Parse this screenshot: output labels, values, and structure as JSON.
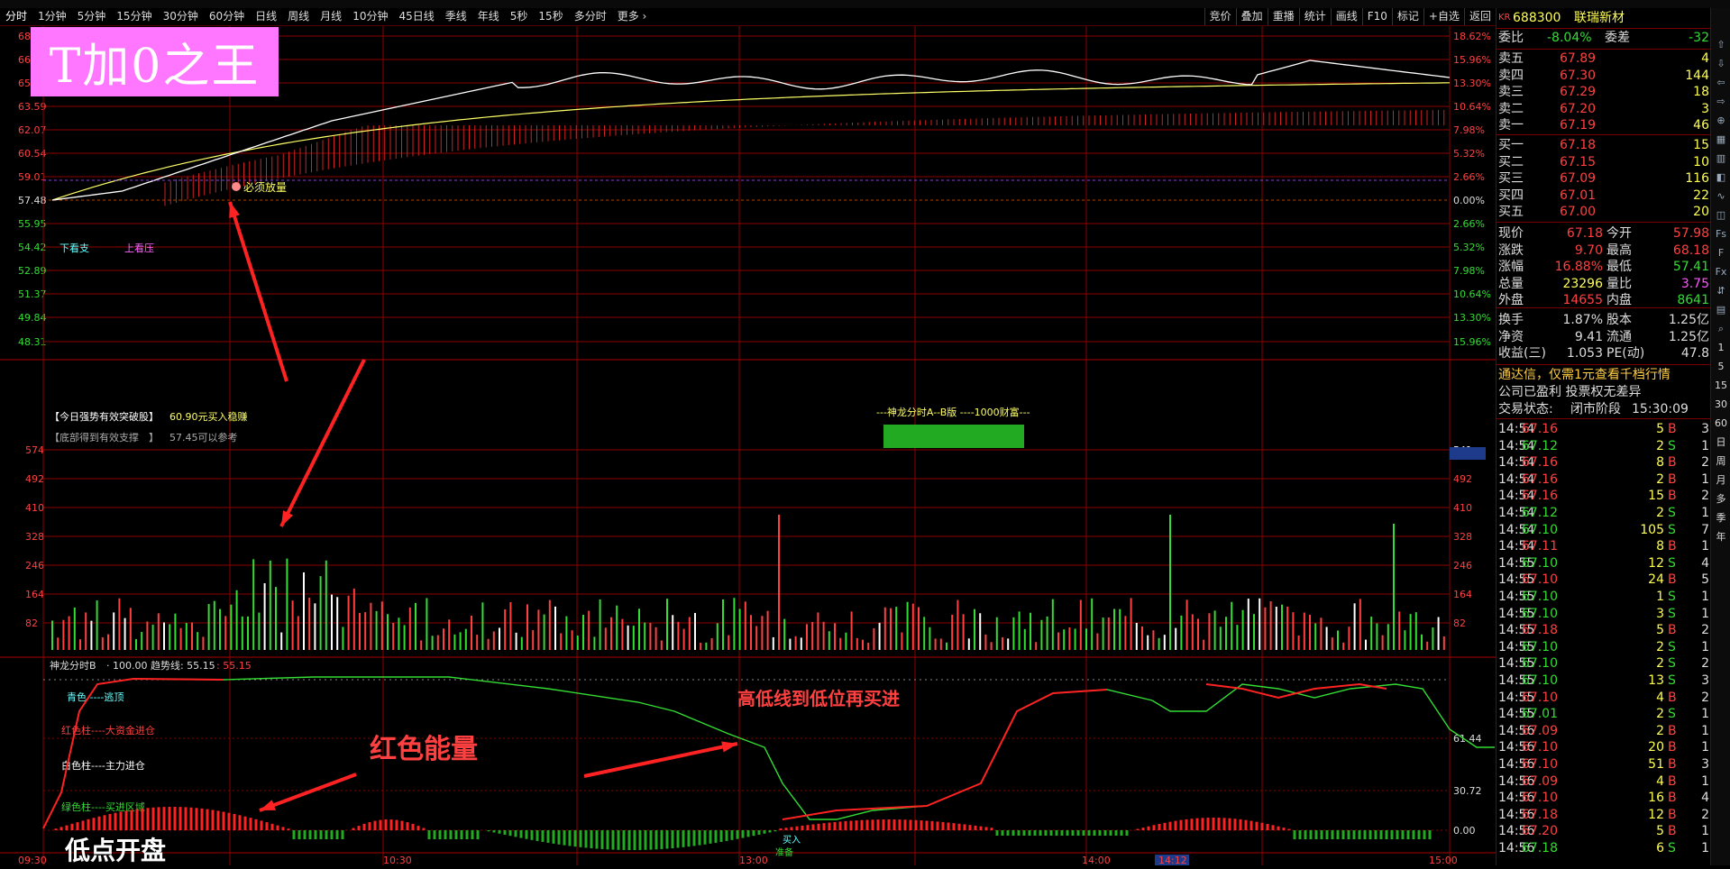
{
  "toolbar": {
    "tabs": [
      "分时",
      "1分钟",
      "5分钟",
      "15分钟",
      "30分钟",
      "60分钟",
      "日线",
      "周线",
      "月线",
      "10分钟",
      "45日线",
      "季线",
      "年线",
      "5秒",
      "15秒",
      "多分时",
      "更多 ›"
    ],
    "right": [
      "竞价",
      "叠加",
      "重播",
      "统计",
      "画线",
      "F10",
      "标记",
      "+自选",
      "返回"
    ]
  },
  "logo": "T加0之王",
  "price_axis": {
    "left": [
      "68",
      "66",
      "65.12",
      "63.59",
      "62.07",
      "60.54",
      "59.01",
      "57.48",
      "55.95",
      "54.42",
      "52.89",
      "51.37",
      "49.84",
      "48.31"
    ],
    "right": [
      "18.62%",
      "15.96%",
      "13.30%",
      "10.64%",
      "7.98%",
      "5.32%",
      "2.66%",
      "0.00%",
      "2.66%",
      "5.32%",
      "7.98%",
      "10.64%",
      "13.30%",
      "15.96%"
    ]
  },
  "volume_axis": {
    "left": [
      "574",
      "492",
      "410",
      "328",
      "246",
      "164",
      "82"
    ],
    "right": [
      "541",
      "492",
      "410",
      "328",
      "246",
      "164",
      "82"
    ]
  },
  "chart_labels": {
    "must_volume": "必须放量",
    "lower_look": "下看支",
    "upper_look": "上看压",
    "breakthrough_prefix": "【今日强势有效突破股】",
    "breakthrough_value": "60.90元买入稳赚",
    "bottom_prefix": "【底部得到有效支撑　】",
    "bottom_value": "57.45可以参考",
    "banner": "---神龙分时A--B版 ----1000财富---"
  },
  "indicator": {
    "title": "神龙分时B",
    "values_line": "· 100.00  趋势线: 55.15",
    "second_value": ": 55.15",
    "axis": [
      "61.44",
      "30.72",
      "0.00"
    ],
    "legend": [
      "青色 ----逃顶",
      "红色柱----大资金进仓",
      "白色柱----主力进仓",
      "绿色柱----买进区域"
    ],
    "low_label": "准备",
    "buy_label": "买入"
  },
  "time_axis": [
    "09:30",
    "10:30",
    "13:00",
    "14:00",
    "14:12",
    "15:00"
  ],
  "annotations": {
    "low_open": "低点开盘",
    "red_energy": "红色能量",
    "buy_again": "高低线到低位再买进"
  },
  "quote": {
    "code_prefix": "KR",
    "code": "688300",
    "name": "联瑞新材",
    "webi_label": "委比",
    "webi": "-8.04%",
    "weicha_label": "委差",
    "weicha": "-32",
    "asks": [
      {
        "label": "卖五",
        "price": "67.89",
        "vol": "4"
      },
      {
        "label": "卖四",
        "price": "67.30",
        "vol": "144"
      },
      {
        "label": "卖三",
        "price": "67.29",
        "vol": "18"
      },
      {
        "label": "卖二",
        "price": "67.20",
        "vol": "3"
      },
      {
        "label": "卖一",
        "price": "67.19",
        "vol": "46"
      }
    ],
    "bids": [
      {
        "label": "买一",
        "price": "67.18",
        "vol": "15"
      },
      {
        "label": "买二",
        "price": "67.15",
        "vol": "10"
      },
      {
        "label": "买三",
        "price": "67.09",
        "vol": "116"
      },
      {
        "label": "买四",
        "price": "67.01",
        "vol": "22"
      },
      {
        "label": "买五",
        "price": "67.00",
        "vol": "20"
      }
    ],
    "stats": [
      {
        "l1": "现价",
        "v1": "67.18",
        "c1": "#ff4040",
        "l2": "今开",
        "v2": "57.98",
        "c2": "#ff4040"
      },
      {
        "l1": "涨跌",
        "v1": "9.70",
        "c1": "#ff4040",
        "l2": "最高",
        "v2": "68.18",
        "c2": "#ff4040"
      },
      {
        "l1": "涨幅",
        "v1": "16.88%",
        "c1": "#ff4040",
        "l2": "最低",
        "v2": "57.41",
        "c2": "#33dd33"
      },
      {
        "l1": "总量",
        "v1": "23296",
        "c1": "#ffff55",
        "l2": "量比",
        "v2": "3.75",
        "c2": "#ff55ff"
      },
      {
        "l1": "外盘",
        "v1": "14655",
        "c1": "#ff4040",
        "l2": "内盘",
        "v2": "8641",
        "c2": "#33dd33"
      }
    ],
    "stats2": [
      {
        "l1": "换手",
        "v1": "1.87%",
        "l2": "股本",
        "v2": "1.25亿"
      },
      {
        "l1": "净资",
        "v1": "9.41",
        "l2": "流通",
        "v2": "1.25亿"
      },
      {
        "l1": "收益(三)",
        "v1": "1.053",
        "l2": "PE(动)",
        "v2": "47.8"
      }
    ],
    "notice": "通达信，仅需1元查看千档行情",
    "company": "公司已盈利 投票权无差异",
    "status_label": "交易状态:",
    "status": "闭市阶段",
    "status_time": "15:30:09"
  },
  "trades": [
    [
      "14:54",
      "67.16",
      "5",
      "B",
      "3"
    ],
    [
      "14:54",
      "67.12",
      "2",
      "S",
      "1"
    ],
    [
      "14:54",
      "67.16",
      "8",
      "B",
      "2"
    ],
    [
      "14:54",
      "67.16",
      "2",
      "B",
      "1"
    ],
    [
      "14:54",
      "67.16",
      "15",
      "B",
      "2"
    ],
    [
      "14:54",
      "67.12",
      "2",
      "S",
      "1"
    ],
    [
      "14:54",
      "67.10",
      "105",
      "S",
      "7"
    ],
    [
      "14:54",
      "67.11",
      "8",
      "B",
      "1"
    ],
    [
      "14:55",
      "67.10",
      "12",
      "S",
      "4"
    ],
    [
      "14:55",
      "67.10",
      "24",
      "B",
      "5"
    ],
    [
      "14:55",
      "67.10",
      "1",
      "S",
      "1"
    ],
    [
      "14:55",
      "67.10",
      "3",
      "S",
      "1"
    ],
    [
      "14:55",
      "67.18",
      "5",
      "B",
      "2"
    ],
    [
      "14:55",
      "67.10",
      "2",
      "S",
      "1"
    ],
    [
      "14:55",
      "67.10",
      "2",
      "S",
      "2"
    ],
    [
      "14:55",
      "67.10",
      "13",
      "S",
      "3"
    ],
    [
      "14:55",
      "67.10",
      "4",
      "B",
      "2"
    ],
    [
      "14:55",
      "67.01",
      "2",
      "S",
      "1"
    ],
    [
      "14:56",
      "67.09",
      "2",
      "B",
      "1"
    ],
    [
      "14:56",
      "67.10",
      "20",
      "B",
      "1"
    ],
    [
      "14:56",
      "67.10",
      "51",
      "B",
      "3"
    ],
    [
      "14:56",
      "67.09",
      "4",
      "B",
      "1"
    ],
    [
      "14:56",
      "67.10",
      "16",
      "B",
      "4"
    ],
    [
      "14:56",
      "67.18",
      "12",
      "B",
      "2"
    ],
    [
      "14:56",
      "67.20",
      "5",
      "B",
      "1"
    ],
    [
      "14:56",
      "67.18",
      "6",
      "S",
      "1"
    ]
  ],
  "side_icons": [
    "up-arrow",
    "down-arrow",
    "left-arrow",
    "right-arrow",
    "zoom",
    "grid",
    "bar",
    "candle",
    "line",
    "split",
    "fs",
    "f10",
    "fx",
    "share",
    "chart",
    "search",
    "1",
    "5",
    "15",
    "30",
    "60",
    "日",
    "周",
    "月",
    "多",
    "季",
    "年"
  ],
  "colors": {
    "up": "#ff4040",
    "down": "#33dd33",
    "grid": "#8b0000",
    "price": "#ffffff",
    "avg": "#ffff66"
  }
}
